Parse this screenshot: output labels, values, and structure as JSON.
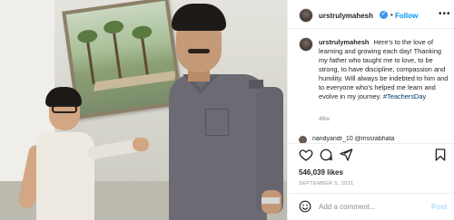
{
  "header": {
    "username": "urstrulymahesh",
    "verified_glyph": "✓",
    "separator": "•",
    "follow_label": "Follow",
    "more_label": "•••"
  },
  "caption": {
    "username": "urstrulymahesh",
    "text": "Here's to the love of learning and growing each day! Thanking my father who taught me to love, to be strong, to have discipline, compassion and humility. Will always be indebted to him and to everyone who's helped me learn and evolve in my journey.",
    "hashtag": "#TeachersDay",
    "age": "48w"
  },
  "comment_peek": {
    "text": "nandyandr_10 @mssrabhata"
  },
  "actions": {
    "like_icon": "heart-icon",
    "comment_icon": "comment-icon",
    "share_icon": "share-icon",
    "save_icon": "bookmark-icon"
  },
  "likes": {
    "text": "546,039 likes"
  },
  "date": "SEPTEMBER 5, 2021",
  "comment_box": {
    "emoji_icon": "smiley-icon",
    "placeholder": "Add a comment...",
    "post_label": "Post"
  },
  "colors": {
    "accent": "#0095f6",
    "post_disabled": "#b2dffc",
    "verified": "#3897f0",
    "muted": "#8e8e8e",
    "text": "#262626"
  }
}
